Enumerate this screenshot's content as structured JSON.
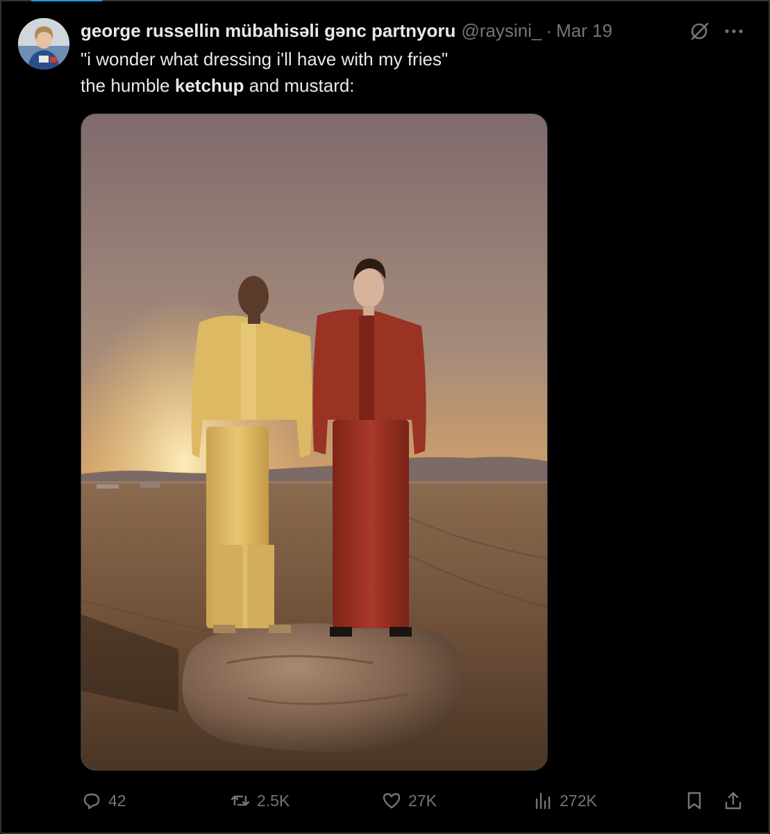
{
  "tweet": {
    "display_name": "george russellin mübahisəli gənc partnyoru",
    "handle": "@raysini_",
    "separator": "·",
    "date": "Mar 19",
    "text_line1": "\"i wonder what dressing i'll have with my fries\"",
    "text_line2_pre": "the humble ",
    "text_line2_bold": "ketchup",
    "text_line2_post": " and mustard:"
  },
  "icons": {
    "header": [
      "grok-icon",
      "more-icon"
    ],
    "actions": [
      "reply-icon",
      "retweet-icon",
      "like-icon",
      "views-icon",
      "bookmark-icon",
      "share-icon"
    ]
  },
  "actions": {
    "replies": "42",
    "retweets": "2.5K",
    "likes": "27K",
    "views": "272K"
  },
  "colors": {
    "background": "#000000",
    "text": "#e7e9ea",
    "muted": "#71767b",
    "accent": "#1d9bf0"
  }
}
